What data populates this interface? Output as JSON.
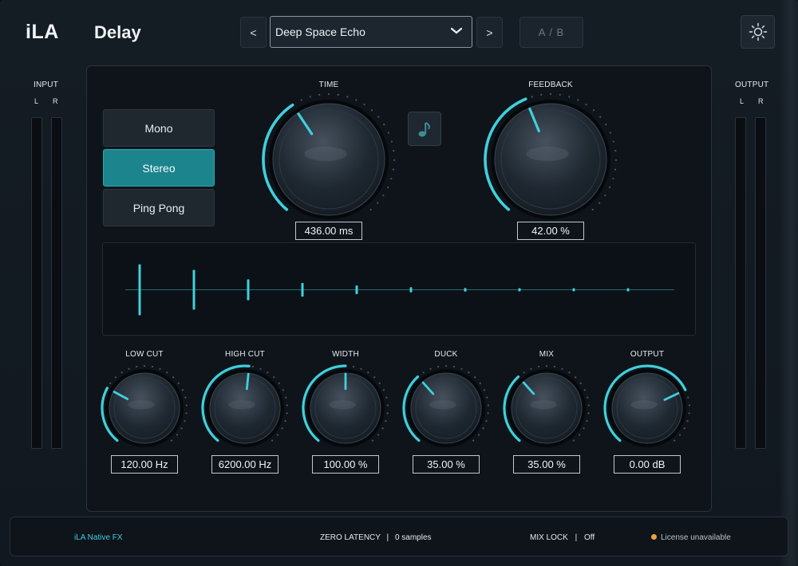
{
  "header": {
    "brand": "iLA",
    "plugin_name": "Delay",
    "prev_label": "<",
    "next_label": ">",
    "preset_name": "Deep Space Echo",
    "ab_label": "A / B"
  },
  "meters": {
    "input": {
      "title": "INPUT",
      "left_label": "L",
      "right_label": "R",
      "level_left": 0,
      "level_right": 0
    },
    "output": {
      "title": "OUTPUT",
      "left_label": "L",
      "right_label": "R",
      "level_left": 0,
      "level_right": 0
    }
  },
  "modes": {
    "items": [
      {
        "label": "Mono",
        "active": false
      },
      {
        "label": "Stereo",
        "active": true
      },
      {
        "label": "Ping Pong",
        "active": false
      }
    ]
  },
  "knobs_large": [
    {
      "id": "time",
      "label": "TIME",
      "value": "436.00 ms",
      "fraction": 0.38
    },
    {
      "id": "feedback",
      "label": "FEEDBACK",
      "value": "42.00 %",
      "fraction": 0.42
    }
  ],
  "knobs_small": [
    {
      "id": "low-cut",
      "label": "LOW CUT",
      "value": "120.00 Hz",
      "fraction": 0.28
    },
    {
      "id": "high-cut",
      "label": "HIGH CUT",
      "value": "6200.00 Hz",
      "fraction": 0.52
    },
    {
      "id": "width",
      "label": "WIDTH",
      "value": "100.00 %",
      "fraction": 0.5
    },
    {
      "id": "duck",
      "label": "DUCK",
      "value": "35.00 %",
      "fraction": 0.35
    },
    {
      "id": "mix",
      "label": "MIX",
      "value": "35.00 %",
      "fraction": 0.35
    },
    {
      "id": "output",
      "label": "OUTPUT",
      "value": "0.00 dB",
      "fraction": 0.73
    }
  ],
  "echo_display": {
    "taps": [
      1.0,
      0.78,
      0.41,
      0.27,
      0.17,
      0.1,
      0.07,
      0.06,
      0.06,
      0.05
    ]
  },
  "footer": {
    "brand": "iLA  Native FX",
    "latency_label": "ZERO LATENCY",
    "latency_value": "0 samples",
    "mix_lock_label": "MIX LOCK",
    "mix_lock_value": "Off",
    "license": "License unavailable"
  },
  "colors": {
    "accent": "#3fd0dc",
    "active_button": "#1c848c",
    "license_dot": "#f0a23a"
  }
}
